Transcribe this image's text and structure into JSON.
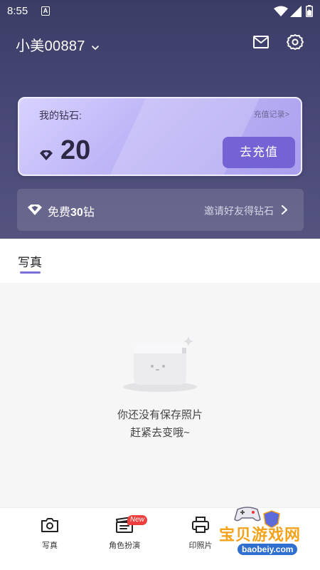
{
  "status_bar": {
    "time": "8:55",
    "notification_letter": "A"
  },
  "header": {
    "username": "小美00887"
  },
  "diamond_card": {
    "label": "我的钻石:",
    "recharge_record": "充值记录>",
    "balance": "20",
    "recharge_button": "去充值"
  },
  "invite": {
    "free_prefix": "免费",
    "free_amount": "30",
    "free_suffix": "钻",
    "invite_text": "邀请好友得钻石"
  },
  "tabs": [
    {
      "label": "写真",
      "active": true
    }
  ],
  "empty_state": {
    "line1": "你还没有保存照片",
    "line2": "赶紧去变哦~"
  },
  "bottom_nav": {
    "items": [
      {
        "label": "写真",
        "icon": "camera-icon"
      },
      {
        "label": "角色扮演",
        "icon": "clapperboard-icon",
        "badge": "New"
      },
      {
        "label": "印照片",
        "icon": "printer-icon"
      }
    ]
  },
  "watermark": {
    "title": "宝贝游戏网",
    "url": "baobeiy.com"
  },
  "colors": {
    "header_bg": "#4a4978",
    "card_bg": "#bfb6f7",
    "accent": "#7563d6",
    "badge": "#ee3e3e"
  }
}
